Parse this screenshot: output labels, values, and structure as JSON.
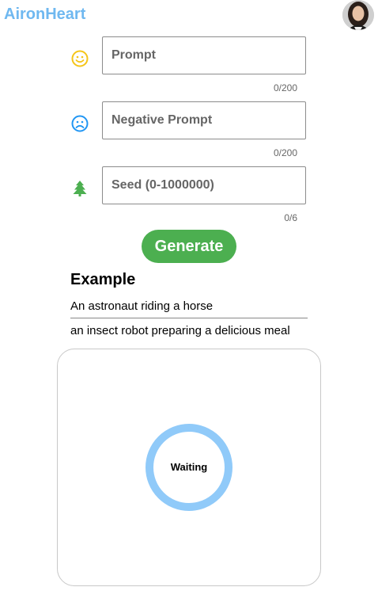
{
  "header": {
    "brand": "AironHeart",
    "avatar_icon": "user-avatar"
  },
  "form": {
    "prompt": {
      "icon": "smile-icon",
      "icon_color": "#f5c518",
      "placeholder": "Prompt",
      "value": "",
      "counter": "0/200"
    },
    "negative_prompt": {
      "icon": "frown-icon",
      "icon_color": "#2196f3",
      "placeholder": "Negative Prompt",
      "value": "",
      "counter": "0/200"
    },
    "seed": {
      "icon": "tree-icon",
      "icon_color": "#4caf50",
      "placeholder": "Seed (0-1000000)",
      "value": "",
      "counter": "0/6"
    },
    "generate_label": "Generate",
    "generate_color": "#4caf50"
  },
  "examples": {
    "title": "Example",
    "items": [
      "An astronaut riding a horse",
      "an insect robot preparing a delicious meal"
    ]
  },
  "result": {
    "status": "Waiting",
    "spinner_color": "#90caf9"
  }
}
